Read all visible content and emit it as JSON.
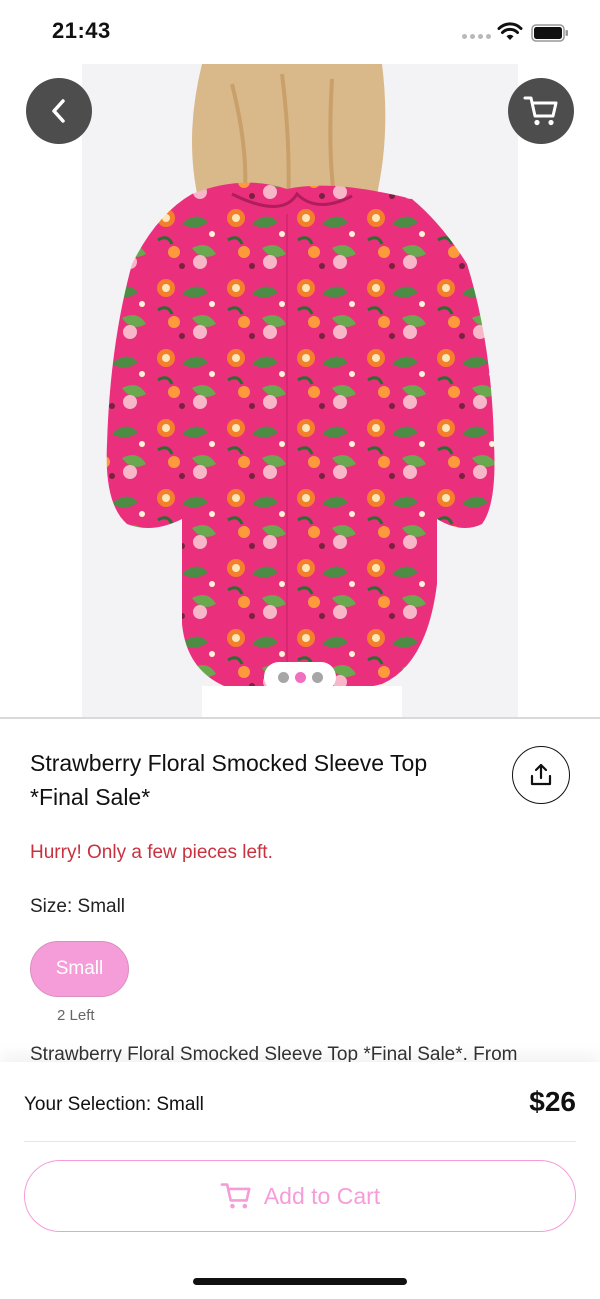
{
  "status_bar": {
    "time": "21:43",
    "icons": [
      "signal-dots-icon",
      "wifi-icon",
      "battery-icon"
    ]
  },
  "header": {
    "back_icon": "chevron-left-icon",
    "cart_icon": "cart-icon"
  },
  "gallery": {
    "image_count": 3,
    "active_index": 1,
    "accent_color": "#f06fc0"
  },
  "product": {
    "title": "Strawberry Floral Smocked Sleeve Top *Final Sale*",
    "share_icon": "share-icon",
    "stock_warning": "Hurry! Only a few pieces left.",
    "size_label": "Size: Small",
    "size_option": "Small",
    "size_left": "2 Left",
    "description": "Strawberry Floral Smocked Sleeve Top *Final Sale*. From"
  },
  "bottom": {
    "selection_label": "Your Selection: Small",
    "price": "$26",
    "add_to_cart": "Add to Cart"
  },
  "colors": {
    "brand_pink": "#f59dd9",
    "warning_red": "#c8323f"
  }
}
